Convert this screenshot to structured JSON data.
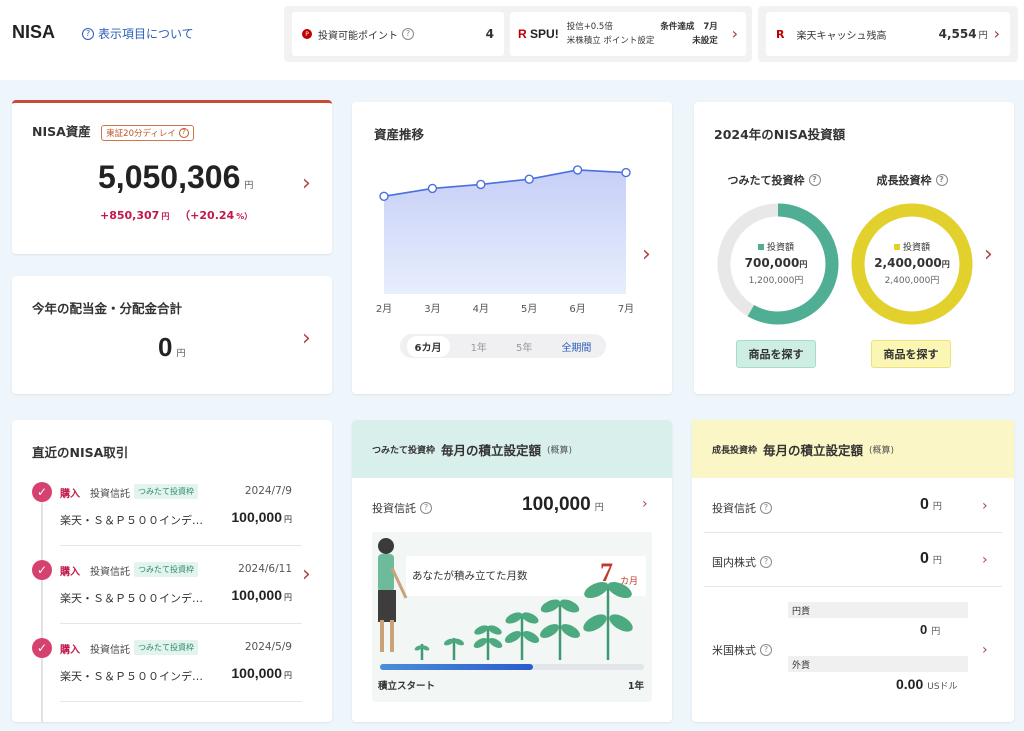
{
  "header": {
    "title": "NISA",
    "help_link": "表示項目について",
    "points_label": "投資可能ポイント",
    "points_value": "4",
    "spu_logo": "SPU!",
    "spu_line1": "投信+0.5倍",
    "spu_line2": "米株積立 ポイント設定",
    "spu_cond_label": "条件達成",
    "spu_cond_value": "7月",
    "spu_status": "未設定",
    "cash_label": "楽天キャッシュ残高",
    "cash_value": "4,554",
    "cash_unit": "円"
  },
  "assets": {
    "title": "NISA資産",
    "delay_badge": "東証20分ディレイ",
    "value": "5,050,306",
    "unit": "円",
    "change": "+850,307",
    "change_unit": "円",
    "change_pct": "（+20.24",
    "pct_unit": "%）"
  },
  "dividends": {
    "title": "今年の配当金・分配金合計",
    "value": "0",
    "unit": "円"
  },
  "trend": {
    "title": "資産推移",
    "tabs": [
      "6カ月",
      "1年",
      "5年",
      "全期間"
    ]
  },
  "chart_data": {
    "type": "area",
    "title": "資産推移",
    "categories": [
      "2月",
      "3月",
      "4月",
      "5月",
      "6月",
      "7月"
    ],
    "values": [
      0.74,
      0.8,
      0.83,
      0.87,
      0.94,
      0.92
    ],
    "color": "#4a6fe0"
  },
  "nisa_invest": {
    "title": "2024年のNISA投資額",
    "tsumitate_label": "つみたて投資枠",
    "growth_label": "成長投資枠",
    "legend": "投資額",
    "tsumitate_amount": "700,000",
    "tsumitate_limit": "1,200,000",
    "growth_amount": "2,400,000",
    "growth_limit": "2,400,000",
    "unit": "円",
    "find_button": "商品を探す",
    "tsumitate_ratio": 0.5833,
    "growth_ratio": 1.0,
    "tsumitate_color": "#4fae93",
    "growth_color": "#e2d12c"
  },
  "transactions": {
    "title": "直近のNISA取引",
    "items": [
      {
        "type": "購入",
        "kind": "投資信託",
        "tag": "つみたて投資枠",
        "date": "2024/7/9",
        "name": "楽天・Ｓ＆Ｐ５００インデ…",
        "amount": "100,000",
        "unit": "円"
      },
      {
        "type": "購入",
        "kind": "投資信託",
        "tag": "つみたて投資枠",
        "date": "2024/6/11",
        "name": "楽天・Ｓ＆Ｐ５００インデ…",
        "amount": "100,000",
        "unit": "円"
      },
      {
        "type": "購入",
        "kind": "投資信託",
        "tag": "つみたて投資枠",
        "date": "2024/5/9",
        "name": "楽天・Ｓ＆Ｐ５００インデ…",
        "amount": "100,000",
        "unit": "円"
      }
    ]
  },
  "monthly_tsumitate": {
    "tag": "つみたて投資枠",
    "title": "毎月の積立設定額",
    "note": "(概算)",
    "fund_label": "投資信託",
    "fund_value": "100,000",
    "unit": "円",
    "months_caption": "あなたが積み立てた月数",
    "months_value": "7",
    "months_unit": "カ月",
    "start_label": "積立スタート",
    "end_label": "1年",
    "progress": 0.58
  },
  "monthly_growth": {
    "tag": "成長投資枠",
    "title": "毎月の積立設定額",
    "note": "(概算)",
    "rows": [
      {
        "label": "投資信託",
        "value": "0",
        "unit": "円"
      },
      {
        "label": "国内株式",
        "value": "0",
        "unit": "円"
      }
    ],
    "us_label": "米国株式",
    "jpy_label": "円貨",
    "jpy_value": "0",
    "jpy_unit": "円",
    "fx_label": "外貨",
    "fx_value": "0.00",
    "fx_unit": "USドル"
  }
}
